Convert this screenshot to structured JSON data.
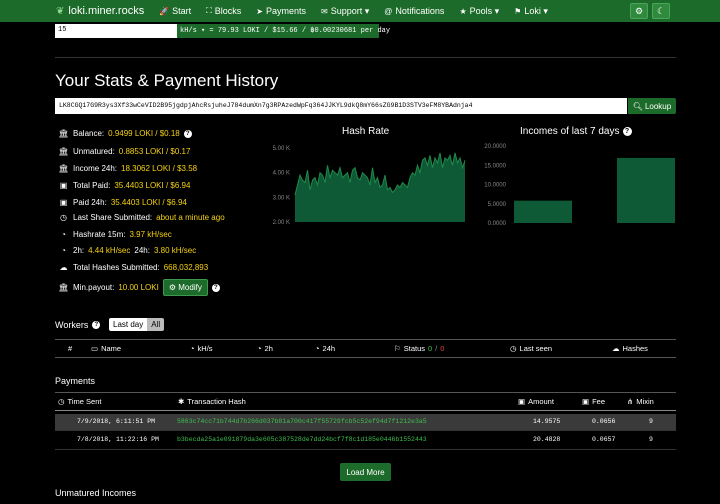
{
  "nav": {
    "brand": "loki.miner.rocks",
    "items": [
      {
        "icon": "rocket-icon",
        "glyph": "🚀",
        "label": "Start"
      },
      {
        "icon": "blocks-icon",
        "glyph": "⛶",
        "label": "Blocks"
      },
      {
        "icon": "send-icon",
        "glyph": "➤",
        "label": "Payments"
      },
      {
        "icon": "support-icon",
        "glyph": "✉",
        "label": "Support ▾"
      },
      {
        "icon": "at-icon",
        "glyph": "@",
        "label": "Notifications"
      },
      {
        "icon": "star-icon",
        "glyph": "★",
        "label": "Pools ▾"
      },
      {
        "icon": "flag-icon",
        "glyph": "⚑",
        "label": "Loki ▾"
      }
    ],
    "right_buttons": [
      "⚙",
      "☾"
    ]
  },
  "calc": {
    "input_value": "15",
    "output": "kH/s ▾ = 79.93 LOKI / $15.66 / ฿0.00230681 per day"
  },
  "title": "Your Stats & Payment History",
  "address": {
    "value": "LK8CGQ17G9R3ys3Xf33wCeVID2B95jgdpjAhcRsjuheJ784dumXn7g3RPAzedWpFq364JJKYL9dkQ8mY66sZG9B1D3STV3eFM8YBAdnja4",
    "button": "Lookup"
  },
  "stats": [
    {
      "icon": "bank-icon",
      "glyph": "🏛",
      "label": "Balance:",
      "value": "0.9499 LOKI / $0.18",
      "help": true
    },
    {
      "icon": "bank-icon",
      "glyph": "🏛",
      "label": "Unmatured:",
      "value": "0.8853 LOKI / $0.17"
    },
    {
      "icon": "bank-icon",
      "glyph": "🏛",
      "label": "Income 24h:",
      "value": "18.3062 LOKI / $3.58"
    },
    {
      "icon": "money-icon",
      "glyph": "▣",
      "label": "Total Paid:",
      "value": "35.4403 LOKI / $6.94"
    },
    {
      "icon": "money-icon",
      "glyph": "▣",
      "label": "Paid 24h:",
      "value": "35.4403 LOKI / $6.94"
    },
    {
      "icon": "clock-icon",
      "glyph": "◷",
      "label": "Last Share Submitted:",
      "value": "about a minute ago"
    },
    {
      "icon": "tachometer-icon",
      "glyph": "◔",
      "label": "Hashrate 15m:",
      "value": "3.97 kH/sec"
    },
    {
      "icon": "tachometer-icon",
      "glyph": "◔",
      "label": "2h:",
      "value": "4.44 kH/sec",
      "label2": "24h:",
      "value2": "3.80 kH/sec"
    },
    {
      "icon": "cloud-upload-icon",
      "glyph": "☁",
      "label": "Total Hashes Submitted:",
      "value": "668,032,893"
    },
    {
      "icon": "bank-icon",
      "glyph": "🏛",
      "label": "Min.payout:",
      "value": "10.00 LOKI",
      "button": "Modify",
      "help": true
    }
  ],
  "chart_data": [
    {
      "type": "area",
      "title": "Hash Rate",
      "ylim": [
        2,
        5
      ],
      "y_ticks": [
        "5.00 K",
        "4.00 K",
        "3.00 K",
        "2.00 K"
      ],
      "values": [
        3.1,
        3.5,
        3.9,
        3.7,
        3.6,
        4.1,
        3.3,
        3.7,
        3.8,
        3.5,
        4.0,
        3.9,
        3.6,
        4.3,
        3.8,
        4.1,
        4.0,
        3.9,
        4.2,
        3.8,
        3.9,
        4.0,
        3.6,
        4.1,
        4.2,
        3.8,
        3.7,
        4.0,
        3.9,
        3.8,
        3.5,
        4.2,
        3.6,
        3.8,
        3.4,
        3.5,
        3.9,
        3.3,
        3.4,
        3.2,
        3.3,
        3.5,
        3.4,
        3.6,
        3.5,
        3.4,
        3.8,
        4.0,
        3.9,
        4.3,
        4.0,
        4.5,
        4.6,
        4.3,
        4.7,
        4.2,
        4.6,
        4.4,
        4.8,
        4.2,
        4.6,
        4.5,
        4.7,
        4.3,
        4.8,
        4.4,
        4.6,
        4.2,
        4.5
      ]
    },
    {
      "type": "bar",
      "title": "Incomes of last 7 days",
      "ylim": [
        0,
        20
      ],
      "y_ticks": [
        "20.0000",
        "15.0000",
        "10.0000",
        "5.0000",
        "0.0000"
      ],
      "values": [
        5.8,
        16.9
      ]
    }
  ],
  "workers": {
    "label": "Workers",
    "toggle": [
      "Last day",
      "All"
    ],
    "columns": [
      "#",
      "Name",
      "kH/s",
      "2h",
      "24h",
      "Status",
      "0",
      "0",
      "Last seen",
      "Hashes"
    ]
  },
  "payments": {
    "label": "Payments",
    "columns": [
      "Time Sent",
      "Transaction Hash",
      "Amount",
      "Fee",
      "Mixin"
    ],
    "rows": [
      {
        "time": "7/9/2018, 6:11:51 PM",
        "hash": "5863c74cc71b744d7b266d037b81a700c417f55729fcb5c52ef94d7f1212e3a5",
        "amount": "14.9575",
        "fee": "0.0656",
        "mixin": "9"
      },
      {
        "time": "7/8/2018, 11:22:16 PM",
        "hash": "b3becda25a1e091879da3e605c387528de7dd24bcf7f8c1d185e0446b1552443",
        "amount": "20.4828",
        "fee": "0.0657",
        "mixin": "9"
      }
    ],
    "load_more": "Load More"
  },
  "unmatured_label": "Unmatured Incomes"
}
